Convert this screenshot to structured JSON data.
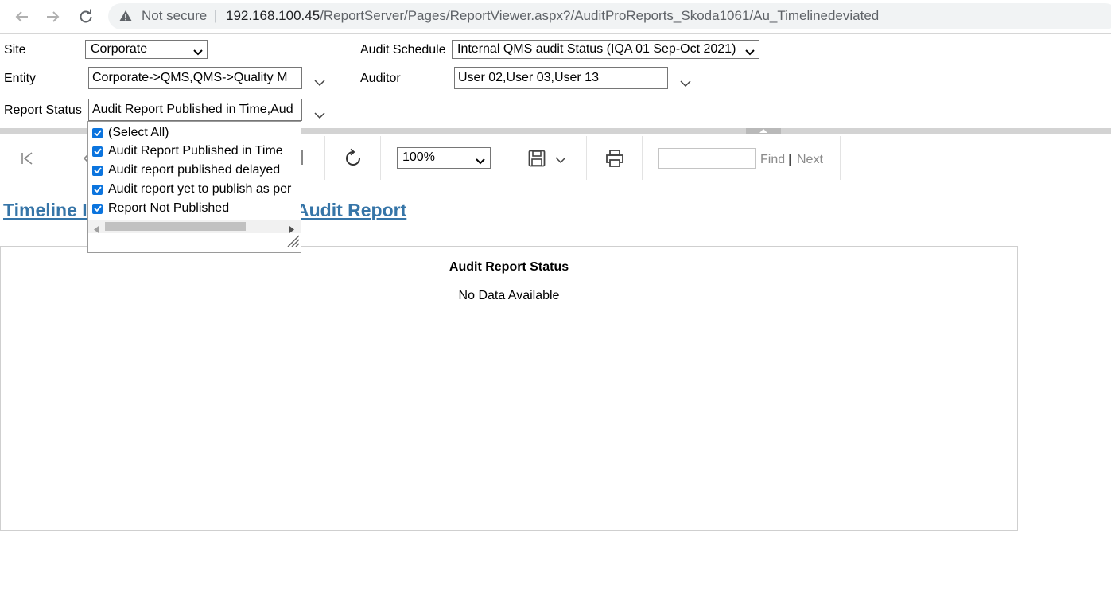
{
  "browser": {
    "security_label": "Not secure",
    "separator": "|",
    "url_host": "192.168.100.45",
    "url_path": "/ReportServer/Pages/ReportViewer.aspx?/AuditProReports_Skoda1061/Au_Timelinedeviated"
  },
  "params": {
    "site": {
      "label": "Site",
      "value": "Corporate"
    },
    "entity": {
      "label": "Entity",
      "value": "Corporate->QMS,QMS->Quality M"
    },
    "report_status": {
      "label": "Report Status",
      "value": "Audit Report Published in Time,Aud"
    },
    "audit_schedule": {
      "label": "Audit Schedule",
      "value": "Internal QMS audit Status (IQA 01 Sep-Oct 2021)"
    },
    "auditor": {
      "label": "Auditor",
      "value": "User 02,User 03,User  13"
    }
  },
  "status_dropdown": {
    "items": [
      {
        "label": "(Select All)",
        "checked": true
      },
      {
        "label": "Audit Report Published in Time",
        "checked": true
      },
      {
        "label": "Audit report published delayed",
        "checked": true
      },
      {
        "label": "Audit report yet to publish as per",
        "checked": true
      },
      {
        "label": "Report Not Published",
        "checked": true
      }
    ]
  },
  "toolbar": {
    "zoom": "100%",
    "find_label": "Find",
    "find_separator": "|",
    "next_label": "Next"
  },
  "report": {
    "title_part1": "Timeline I",
    "title_part2": "Audit Report",
    "box_title": "Audit Report Status",
    "box_message": "No Data Available"
  },
  "colors": {
    "link": "#3675a8",
    "checkbox": "#0b74de",
    "splitter": "#d3d3d3"
  },
  "icons": [
    "back-arrow-icon",
    "forward-arrow-icon",
    "reload-icon",
    "warning-icon",
    "first-page-icon",
    "previous-page-icon",
    "refresh-icon",
    "save-icon",
    "print-icon"
  ]
}
